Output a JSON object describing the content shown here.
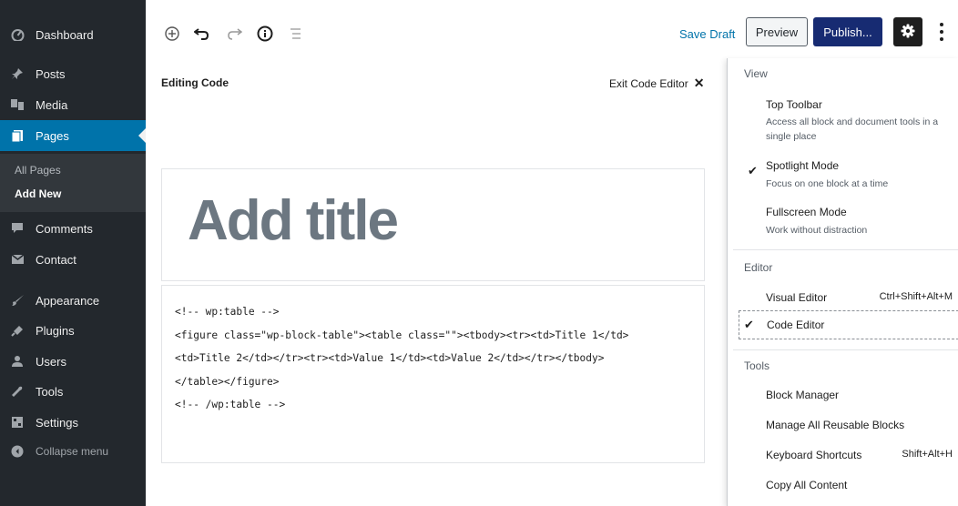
{
  "sidebar": {
    "items": [
      {
        "label": "Dashboard",
        "icon": "dashboard-icon"
      },
      {
        "label": "Posts",
        "icon": "pin-icon"
      },
      {
        "label": "Media",
        "icon": "media-icon"
      },
      {
        "label": "Pages",
        "icon": "pages-icon"
      },
      {
        "label": "Comments",
        "icon": "comment-icon"
      },
      {
        "label": "Contact",
        "icon": "mail-icon"
      },
      {
        "label": "Appearance",
        "icon": "brush-icon"
      },
      {
        "label": "Plugins",
        "icon": "plugin-icon"
      },
      {
        "label": "Users",
        "icon": "users-icon"
      },
      {
        "label": "Tools",
        "icon": "wrench-icon"
      },
      {
        "label": "Settings",
        "icon": "settings-icon"
      }
    ],
    "submenu": [
      "All Pages",
      "Add New"
    ],
    "collapse_label": "Collapse menu",
    "active_color": "#0073aa"
  },
  "toolbar": {
    "save_draft": "Save Draft",
    "preview": "Preview",
    "publish": "Publish...",
    "publish_color": "#172b72"
  },
  "editor": {
    "heading": "Editing Code",
    "exit_label": "Exit Code Editor",
    "title_placeholder": "Add title",
    "code": "<!-- wp:table -->\n<figure class=\"wp-block-table\"><table class=\"\"><tbody><tr><td>Title 1</td>\n<td>Title 2</td></tr><tr><td>Value 1</td><td>Value 2</td></tr></tbody>\n</table></figure>\n<!-- /wp:table -->"
  },
  "menu": {
    "view": {
      "label": "View",
      "top_toolbar": {
        "title": "Top Toolbar",
        "desc": "Access all block and document tools in a single place"
      },
      "spotlight": {
        "title": "Spotlight Mode",
        "desc": "Focus on one block at a time",
        "checked": true
      },
      "fullscreen": {
        "title": "Fullscreen Mode",
        "desc": "Work without distraction"
      }
    },
    "editor": {
      "label": "Editor",
      "visual": {
        "title": "Visual Editor",
        "shortcut": "Ctrl+Shift+Alt+M"
      },
      "code": {
        "title": "Code Editor",
        "checked": true
      }
    },
    "tools": {
      "label": "Tools",
      "block_manager": "Block Manager",
      "reusable": "Manage All Reusable Blocks",
      "shortcuts": {
        "title": "Keyboard Shortcuts",
        "shortcut": "Shift+Alt+H"
      },
      "copy": "Copy All Content"
    }
  }
}
